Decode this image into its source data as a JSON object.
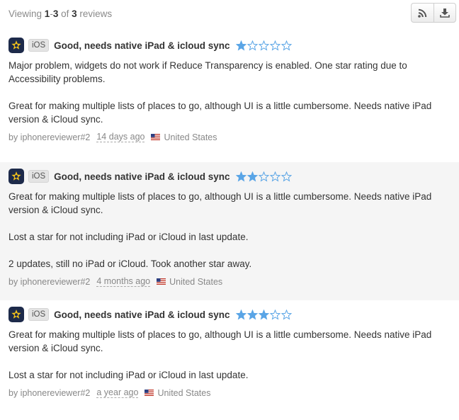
{
  "summary": {
    "prefix": "Viewing ",
    "range_start": "1",
    "range_sep": "-",
    "range_end": "3",
    "of": " of ",
    "total": "3",
    "suffix": " reviews"
  },
  "toolbar": {
    "rss_icon": "rss-icon",
    "download_icon": "download-icon"
  },
  "colors": {
    "star_filled": "#5aa5e6",
    "star_empty_stroke": "#5aa5e6",
    "alt_row_bg": "#f5f5f5"
  },
  "reviews": [
    {
      "platform": "iOS",
      "title": "Good, needs native iPad & icloud sync",
      "rating": 1,
      "paragraphs": [
        "Major problem, widgets do not work if Reduce Transparency is enabled. One star rating due to Accessibility problems.",
        "Great for making multiple lists of places to go, although UI is a little cumbersome. Needs native iPad version & iCloud sync."
      ],
      "author": "by iphonereviewer#2",
      "date": "14 days ago",
      "country": "United States"
    },
    {
      "platform": "iOS",
      "title": "Good, needs native iPad & icloud sync",
      "rating": 2,
      "paragraphs": [
        "Great for making multiple lists of places to go, although UI is a little cumbersome. Needs native iPad version & iCloud sync.",
        "Lost a star for not including iPad or iCloud in last update.",
        "2 updates, still no iPad or iCloud. Took another star away."
      ],
      "author": "by iphonereviewer#2",
      "date": "4 months ago",
      "country": "United States"
    },
    {
      "platform": "iOS",
      "title": "Good, needs native iPad & icloud sync",
      "rating": 3,
      "paragraphs": [
        "Great for making multiple lists of places to go, although UI is a little cumbersome. Needs native iPad version & iCloud sync.",
        "Lost a star for not including iPad or iCloud in last update."
      ],
      "author": "by iphonereviewer#2",
      "date": "a year ago",
      "country": "United States"
    }
  ]
}
